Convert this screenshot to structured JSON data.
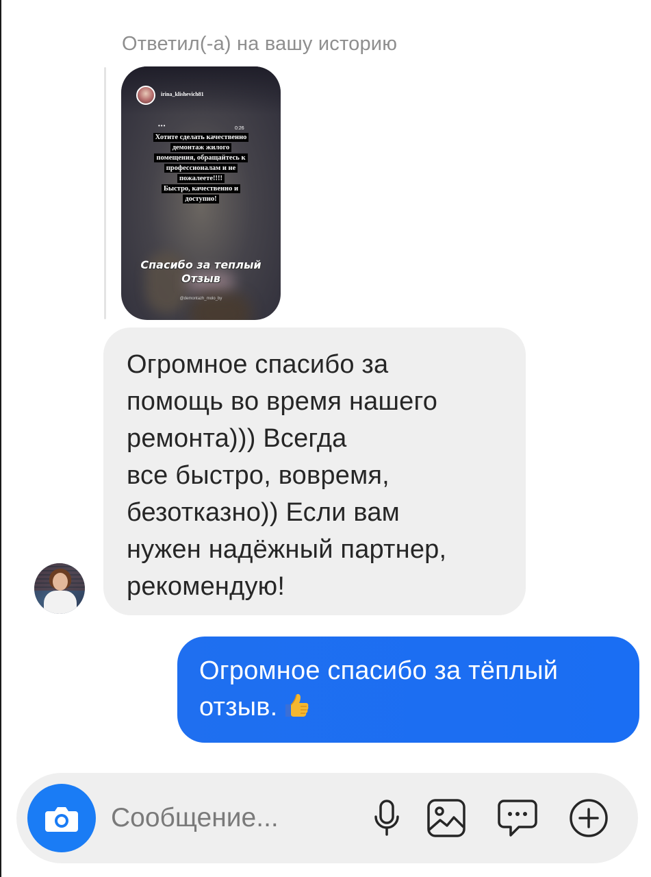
{
  "thread": {
    "reply_caption": "Ответил(-а) на вашу историю",
    "story": {
      "username": "irina_klishevich81",
      "dots": "•••",
      "time": "0:26",
      "text_lines": [
        "Хотите сделать качественно",
        "демонтаж жилого",
        "помещения, обращайтесь к",
        "профессионалам и не",
        "пожалеете!!!!",
        "Быстро, качественно и",
        "доступно!"
      ],
      "caption_line1": "Спасибо за теплый",
      "caption_line2": "Отзыв",
      "handle": "@demontazh_molo_by"
    },
    "incoming_message": {
      "lines": [
        "Огромное спасибо за",
        "помощь во время нашего",
        "ремонта))) Всегда",
        "все быстро, вовремя,",
        "безотказно)) Если вам",
        "нужен надёжный партнер,",
        "рекомендую!"
      ]
    },
    "outgoing_message": {
      "line1": "Огромное спасибо за тёплый",
      "line2": "отзыв.",
      "emoji_icon": "thumbs-up-icon"
    }
  },
  "composer": {
    "placeholder": "Сообщение...",
    "camera_icon": "camera-icon",
    "actions": [
      "microphone-icon",
      "gallery-icon",
      "sticker-chat-icon",
      "add-circle-icon"
    ]
  },
  "colors": {
    "accent": "#1a7cf5",
    "outgoing_bubble": "#1d6ef2",
    "incoming_bubble": "#efefef",
    "muted_text": "#8e8e8e"
  }
}
